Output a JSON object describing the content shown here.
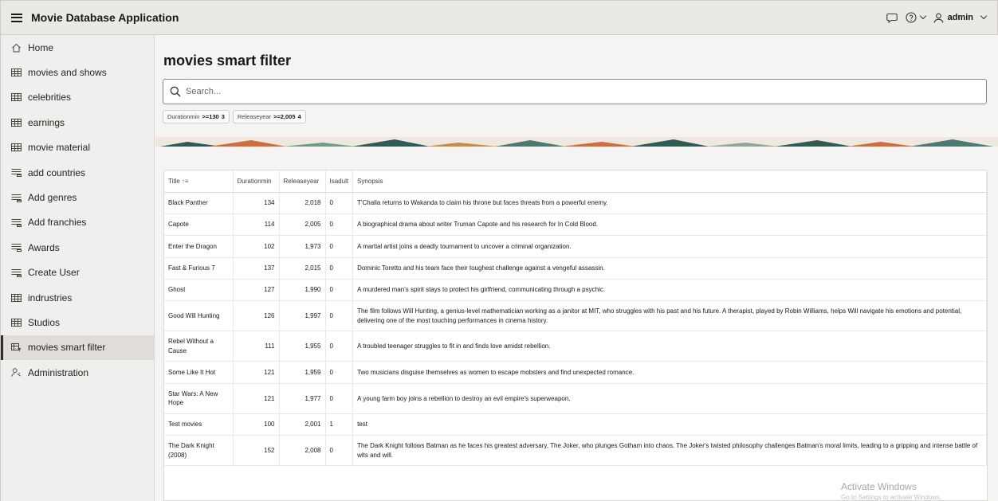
{
  "header": {
    "title": "Movie Database Application",
    "user": "admin"
  },
  "sidebar": {
    "items": [
      {
        "label": "Home",
        "icon": "home-icon"
      },
      {
        "label": "movies and shows",
        "icon": "table-icon"
      },
      {
        "label": "celebrities",
        "icon": "table-icon"
      },
      {
        "label": "earnings",
        "icon": "table-icon"
      },
      {
        "label": "movie material",
        "icon": "table-icon"
      },
      {
        "label": "add countries",
        "icon": "form-icon"
      },
      {
        "label": "Add genres",
        "icon": "form-icon"
      },
      {
        "label": "Add franchies",
        "icon": "form-icon"
      },
      {
        "label": "Awards",
        "icon": "form-icon"
      },
      {
        "label": "Create User",
        "icon": "form-icon"
      },
      {
        "label": "indrustries",
        "icon": "table-icon"
      },
      {
        "label": "Studios",
        "icon": "table-icon"
      },
      {
        "label": "movies smart filter",
        "icon": "filter-table-icon",
        "active": true
      },
      {
        "label": "Administration",
        "icon": "admin-icon"
      }
    ]
  },
  "main": {
    "title": "movies smart filter",
    "search_placeholder": "Search...",
    "chips": [
      {
        "label": "Durationmin",
        "value": ">=130",
        "count": "3"
      },
      {
        "label": "Releaseyear",
        "value": ">=2,005",
        "count": "4"
      }
    ]
  },
  "table": {
    "columns": [
      "Title",
      "Durationmin",
      "Releaseyear",
      "Isadult",
      "Synopsis"
    ],
    "sort_indicator": "↑≡",
    "rows": [
      {
        "title": "Black Panther",
        "duration": "134",
        "year": "2,018",
        "adult": "0",
        "synopsis": "T'Challa returns to Wakanda to claim his throne but faces threats from a powerful enemy."
      },
      {
        "title": "Capote",
        "duration": "114",
        "year": "2,005",
        "adult": "0",
        "synopsis": "A biographical drama about writer Truman Capote and his research for In Cold Blood."
      },
      {
        "title": "Enter the Dragon",
        "duration": "102",
        "year": "1,973",
        "adult": "0",
        "synopsis": "A martial artist joins a deadly tournament to uncover a criminal organization."
      },
      {
        "title": "Fast & Furious 7",
        "duration": "137",
        "year": "2,015",
        "adult": "0",
        "synopsis": "Dominic Toretto and his team face their toughest challenge against a vengeful assassin."
      },
      {
        "title": "Ghost",
        "duration": "127",
        "year": "1,990",
        "adult": "0",
        "synopsis": "A murdered man's spirit stays to protect his girlfriend, communicating through a psychic."
      },
      {
        "title": "Good Will Hunting",
        "duration": "126",
        "year": "1,997",
        "adult": "0",
        "synopsis": "The film follows Will Hunting, a genius-level mathematician working as a janitor at MIT, who struggles with his past and his future. A therapist, played by Robin Williams, helps Will navigate his emotions and potential, delivering one of the most touching performances in cinema history."
      },
      {
        "title": "Rebel Without a Cause",
        "duration": "111",
        "year": "1,955",
        "adult": "0",
        "synopsis": "A troubled teenager struggles to fit in and finds love amidst rebellion."
      },
      {
        "title": "Some Like It Hot",
        "duration": "121",
        "year": "1,959",
        "adult": "0",
        "synopsis": "Two musicians disguise themselves as women to escape mobsters and find unexpected romance."
      },
      {
        "title": "Star Wars: A New Hope",
        "duration": "121",
        "year": "1,977",
        "adult": "0",
        "synopsis": "A young farm boy joins a rebellion to destroy an evil empire's superweapon."
      },
      {
        "title": "Test movies",
        "duration": "100",
        "year": "2,001",
        "adult": "1",
        "synopsis": "test"
      },
      {
        "title": "The Dark Knight (2008)",
        "duration": "152",
        "year": "2,008",
        "adult": "0",
        "synopsis": "The Dark Knight follows Batman as he faces his greatest adversary, The Joker, who plunges Gotham into chaos. The Joker's twisted philosophy challenges Batman's moral limits, leading to a gripping and intense battle of wits and will."
      }
    ]
  },
  "watermark": {
    "title": "Activate Windows",
    "subtitle": "Go to Settings to activate Windows."
  }
}
